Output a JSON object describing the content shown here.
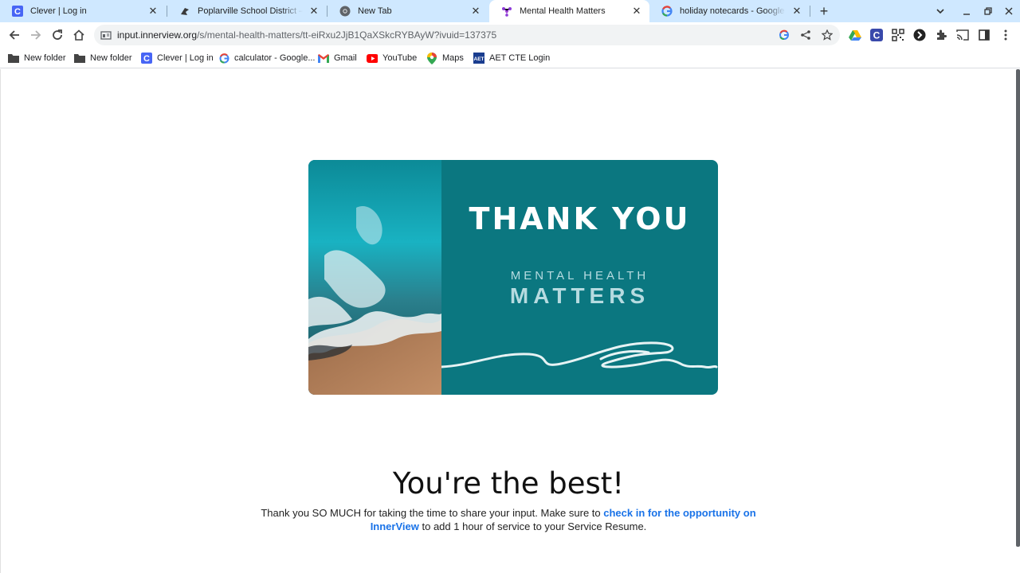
{
  "tabs": [
    {
      "title": "Clever | Log in",
      "icon": "clever-icon",
      "active": false
    },
    {
      "title": "Poplarville School District – Wh",
      "icon": "district-icon",
      "active": false
    },
    {
      "title": "New Tab",
      "icon": "chrome-icon",
      "active": false
    },
    {
      "title": "Mental Health Matters",
      "icon": "innerview-icon",
      "active": true
    },
    {
      "title": "holiday notecards - Google Sea",
      "icon": "google-icon",
      "active": false
    }
  ],
  "toolbar": {
    "url_host": "input.innerview.org",
    "url_path": "/s/mental-health-matters/tt-eiRxu2JjB1QaXSkcRYBAyW?ivuid=137375"
  },
  "bookmarks": [
    {
      "label": "New folder",
      "icon": "folder-icon"
    },
    {
      "label": "New folder",
      "icon": "folder-icon"
    },
    {
      "label": "Clever | Log in",
      "icon": "clever-icon"
    },
    {
      "label": "calculator - Google...",
      "icon": "google-icon"
    },
    {
      "label": "Gmail",
      "icon": "gmail-icon"
    },
    {
      "label": "YouTube",
      "icon": "youtube-icon"
    },
    {
      "label": "Maps",
      "icon": "maps-icon"
    },
    {
      "label": "AET CTE Login",
      "icon": "aet-icon"
    }
  ],
  "card": {
    "thank_you": "THANK YOU",
    "brand_line1": "MENTAL HEALTH",
    "brand_line2": "MATTERS"
  },
  "main": {
    "headline": "You're the best!",
    "text_before": "Thank you SO MUCH for taking the time to share your input. Make sure to ",
    "link_text": "check in for the opportunity on InnerView",
    "text_after": " to add 1 hour of service to your Service Resume."
  },
  "colors": {
    "tabstrip": "#cfe8ff",
    "card_teal": "#0b7780",
    "link": "#1a73e8"
  }
}
